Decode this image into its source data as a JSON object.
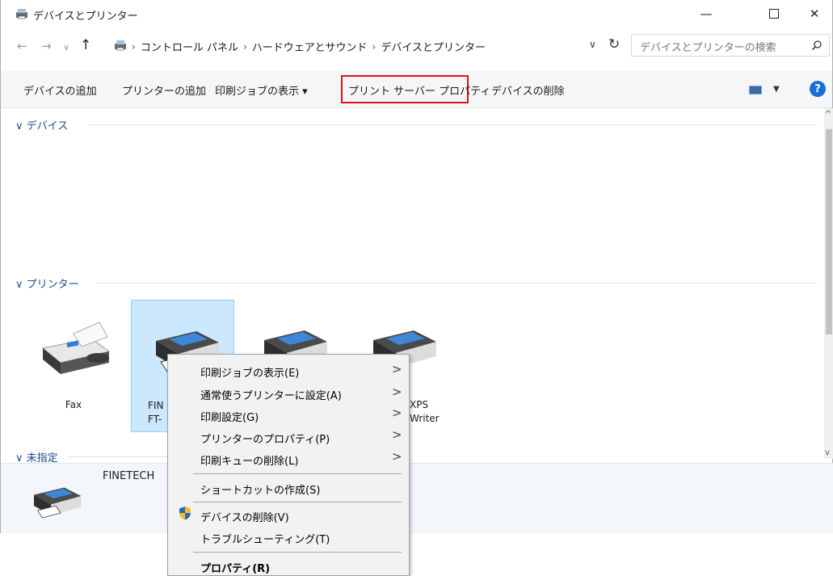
{
  "window": {
    "title": "デバイスとプリンター",
    "minimize": "—",
    "close": "✕"
  },
  "address": {
    "crumbs": [
      "コントロール パネル",
      "ハードウェアとサウンド",
      "デバイスとプリンター"
    ],
    "search_placeholder": "デバイスとプリンターの検索"
  },
  "commands": {
    "add_device": "デバイスの追加",
    "add_printer": "プリンターの追加",
    "view_jobs": "印刷ジョブの表示 ▾",
    "print_server": "プリント サーバー プロパティ",
    "remove_device": "デバイスの削除",
    "help": "?"
  },
  "groups": {
    "devices": "∨ デバイス",
    "printers": "∨ プリンター",
    "unspecified": "∨ 未指定"
  },
  "printers": [
    {
      "label": "Fax",
      "icon": "fax-icon"
    },
    {
      "label": "FIN\nFT-",
      "icon": "printer-icon"
    },
    {
      "label": "",
      "icon": "printer-icon"
    },
    {
      "label": "XPS\nWriter",
      "icon": "printer-icon"
    }
  ],
  "details": {
    "name": "FINETECH"
  },
  "context_menu": {
    "items": [
      "印刷ジョブの表示(E)",
      "通常使うプリンターに設定(A)",
      "印刷設定(G)",
      "プリンターのプロパティ(P)",
      "印刷キューの削除(L)",
      "ショートカットの作成(S)",
      "デバイスの削除(V)",
      "トラブルシューティング(T)",
      "プロパティ(R)"
    ]
  },
  "colors": {
    "highlight_border": "#e0101a",
    "selection": "#cce8ff",
    "group_header": "#1a4a8a"
  }
}
